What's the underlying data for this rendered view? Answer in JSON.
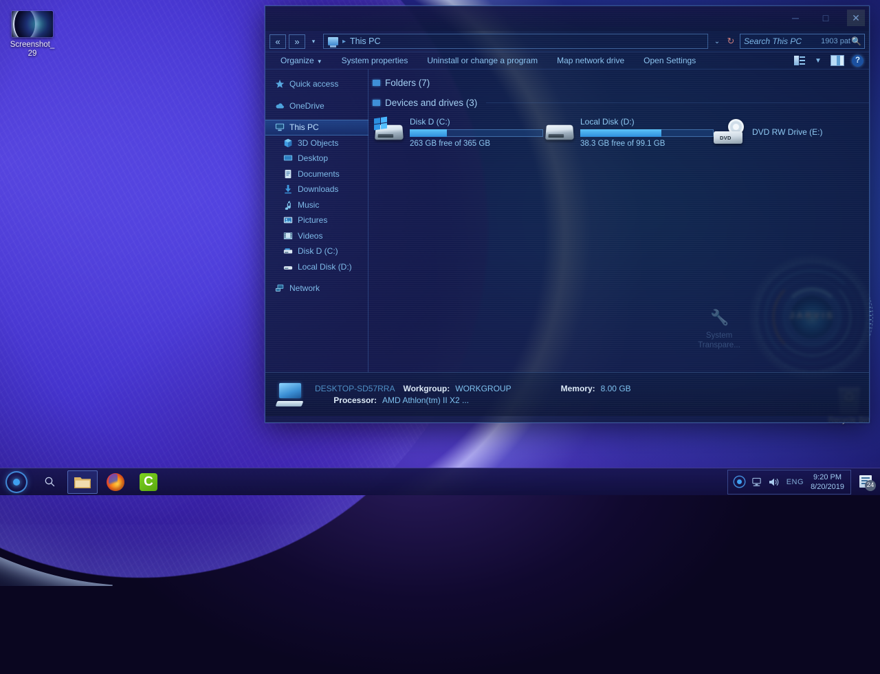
{
  "desktop": {
    "icons": [
      {
        "name": "screenshot-thumb-icon",
        "label": "Screenshot_\n29",
        "line1": "Screenshot_",
        "line2": "29"
      },
      {
        "name": "recycle-bin-icon",
        "label": "Recycle Bin"
      }
    ],
    "widget": {
      "label": "JARVIS"
    }
  },
  "window": {
    "title": "This PC",
    "controls": {
      "minimize": "─",
      "maximize": "□",
      "close": "✕"
    },
    "nav": {
      "back": "«",
      "forward": "»",
      "recent_caret": "▾",
      "breadcrumb_icon": "this-pc-icon",
      "breadcrumb": "This PC",
      "breadcrumb_arrow": "▸",
      "history_caret": "⌄",
      "refresh": "↻"
    },
    "search": {
      "placeholder": "Search This PC",
      "value": "1903 pat",
      "icon": "search-icon"
    },
    "toolbar": {
      "items": [
        {
          "label": "Organize",
          "caret": "▼"
        },
        {
          "label": "System properties"
        },
        {
          "label": "Uninstall or change a program"
        },
        {
          "label": "Map network drive"
        },
        {
          "label": "Open Settings"
        }
      ],
      "view_caret": "▼",
      "help": "?"
    },
    "sidebar": {
      "items": [
        {
          "label": "Quick access",
          "icon": "star-icon",
          "indent": false,
          "selected": false
        },
        {
          "label": "OneDrive",
          "icon": "cloud-icon",
          "indent": false,
          "selected": false
        },
        {
          "label": "This PC",
          "icon": "monitor-icon",
          "indent": false,
          "selected": true
        },
        {
          "label": "3D Objects",
          "icon": "cube-icon",
          "indent": true,
          "selected": false
        },
        {
          "label": "Desktop",
          "icon": "desktop-icon",
          "indent": true,
          "selected": false
        },
        {
          "label": "Documents",
          "icon": "document-icon",
          "indent": true,
          "selected": false
        },
        {
          "label": "Downloads",
          "icon": "download-arrow-icon",
          "indent": true,
          "selected": false
        },
        {
          "label": "Music",
          "icon": "music-note-icon",
          "indent": true,
          "selected": false
        },
        {
          "label": "Pictures",
          "icon": "picture-icon",
          "indent": true,
          "selected": false
        },
        {
          "label": "Videos",
          "icon": "video-icon",
          "indent": true,
          "selected": false
        },
        {
          "label": "Disk D (C:)",
          "icon": "hard-drive-icon",
          "indent": true,
          "selected": false
        },
        {
          "label": "Local Disk (D:)",
          "icon": "hard-drive-icon",
          "indent": true,
          "selected": false
        },
        {
          "label": "Network",
          "icon": "network-icon",
          "indent": false,
          "selected": false
        }
      ]
    },
    "content": {
      "groups": [
        {
          "title": "Folders (7)"
        },
        {
          "title": "Devices and drives (3)"
        }
      ],
      "drives": [
        {
          "name": "Disk D (C:)",
          "free_text": "263 GB free of 365 GB",
          "used_percent": 28,
          "icon": "windows-drive-icon"
        },
        {
          "name": "Local Disk (D:)",
          "free_text": "38.3 GB free of 99.1 GB",
          "used_percent": 61,
          "icon": "hard-drive-icon"
        },
        {
          "name": "DVD RW Drive (E:)",
          "free_text": "",
          "used_percent": 0,
          "icon": "dvd-drive-icon",
          "label": "DVD"
        }
      ],
      "watermark": {
        "line1": "System",
        "line2": "Transpare...",
        "icon": "wrench-icon"
      }
    },
    "statusbar": {
      "computer_name": "DESKTOP-SD57RRA",
      "workgroup_label": "Workgroup:",
      "workgroup_value": "WORKGROUP",
      "memory_label": "Memory:",
      "memory_value": "8.00 GB",
      "processor_label": "Processor:",
      "processor_value": "AMD Athlon(tm) II X2 ..."
    }
  },
  "taskbar": {
    "start": "cortana-orb-icon",
    "search": "⚲",
    "apps": [
      {
        "name": "file-explorer",
        "icon": "folder-icon",
        "active": true
      },
      {
        "name": "firefox",
        "icon": "firefox-icon",
        "active": false
      },
      {
        "name": "camtasia",
        "icon": "camtasia-icon",
        "label": "C",
        "active": false
      }
    ],
    "tray": {
      "network": "὚7",
      "volume": "ὐA",
      "language": "ENG",
      "time": "9:20 PM",
      "date": "8/20/2019",
      "notification_count": "24"
    }
  },
  "colors": {
    "accent": "#3f90d8",
    "text": "#8fc4f0",
    "bar_fill": "#2f8fdc",
    "window_bg": "#0a1634"
  }
}
